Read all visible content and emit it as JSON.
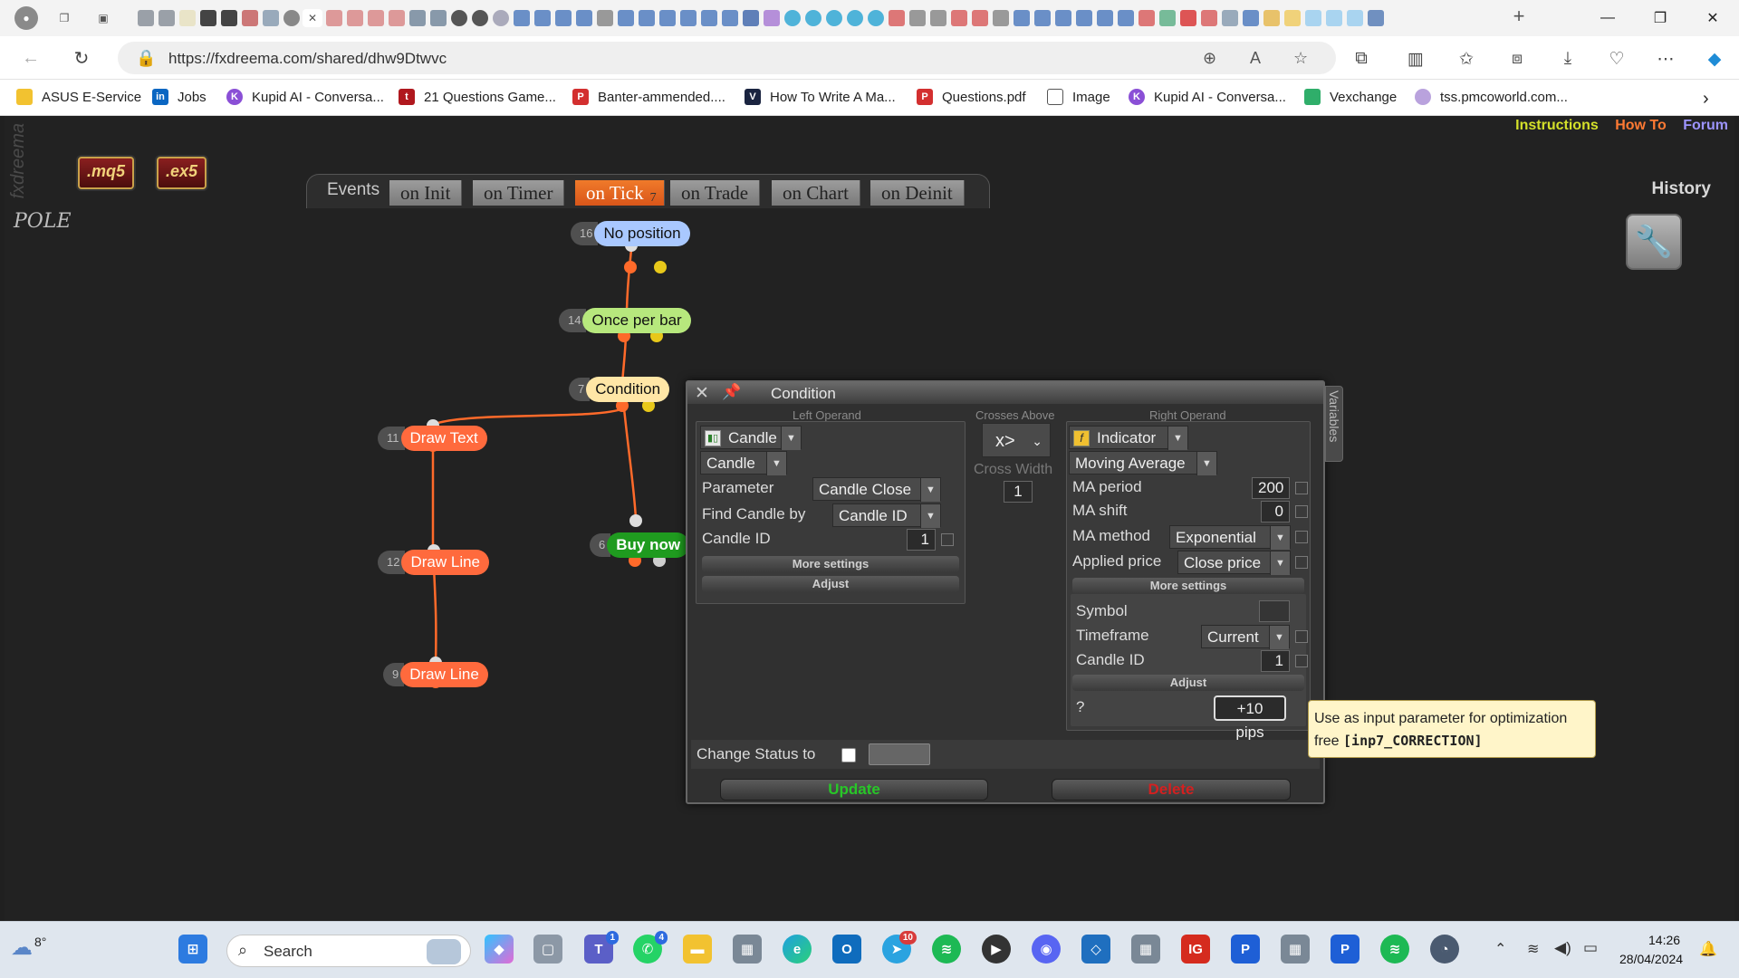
{
  "browser": {
    "url": "https://fxdreema.com/shared/dhw9Dtwvc",
    "bookmarks": [
      "ASUS E-Service",
      "Jobs",
      "Kupid AI - Conversa...",
      "21 Questions Game...",
      "Banter-ammended....",
      "How To Write A Ma...",
      "Questions.pdf",
      "Image",
      "Kupid AI - Conversa...",
      "Vexchange",
      "tss.pmcoworld.com..."
    ],
    "win_controls": {
      "minimize": "—",
      "maximize": "❐",
      "close": "✕"
    }
  },
  "app": {
    "logo_vertical": "fxdreema",
    "links": {
      "instructions": "Instructions",
      "howto": "How To",
      "forum": "Forum"
    },
    "files": {
      "mq5": ".mq5",
      "ex5": ".ex5"
    },
    "project_name": "POLE",
    "events_label": "Events",
    "event_tabs": [
      "on Init",
      "on Timer",
      "on Tick",
      "on Trade",
      "on Chart",
      "on Deinit"
    ],
    "active_tab_badge": "7",
    "history": "History",
    "nodes": [
      {
        "num": "16",
        "label": "No position"
      },
      {
        "num": "14",
        "label": "Once per bar"
      },
      {
        "num": "7",
        "label": "Condition"
      },
      {
        "num": "11",
        "label": "Draw Text"
      },
      {
        "num": "6",
        "label": "Buy now"
      },
      {
        "num": "12",
        "label": "Draw Line"
      },
      {
        "num": "9",
        "label": "Draw Line"
      }
    ]
  },
  "dialog": {
    "title": "Condition",
    "variables_tab": "Variables",
    "left": {
      "section": "Left Operand",
      "type": "Candle",
      "subtype": "Candle",
      "parameter_label": "Parameter",
      "parameter_value": "Candle Close",
      "find_label": "Find Candle by",
      "find_value": "Candle ID",
      "candle_id_label": "Candle ID",
      "candle_id_value": "1",
      "more_settings": "More settings",
      "adjust": "Adjust"
    },
    "middle": {
      "section": "Crosses Above",
      "operator": "x>",
      "cross_width_label": "Cross Width",
      "cross_width_value": "1"
    },
    "right": {
      "section": "Right Operand",
      "type": "Indicator",
      "subtype": "Moving Average",
      "ma_period_label": "MA period",
      "ma_period_value": "200",
      "ma_shift_label": "MA shift",
      "ma_shift_value": "0",
      "ma_method_label": "MA method",
      "ma_method_value": "Exponential",
      "applied_price_label": "Applied price",
      "applied_price_value": "Close price",
      "more_settings": "More settings",
      "symbol_label": "Symbol",
      "symbol_value": "",
      "timeframe_label": "Timeframe",
      "timeframe_value": "Current",
      "candle_id_label": "Candle ID",
      "candle_id_value": "1",
      "adjust": "Adjust",
      "adjust_q": "?",
      "adjust_value": "+10 pips"
    },
    "change_status_label": "Change Status to",
    "update": "Update",
    "delete": "Delete"
  },
  "tooltip": {
    "line1": "Use as input parameter for optimization",
    "line2_prefix": "free ",
    "line2_code": "[inp7_CORRECTION]"
  },
  "taskbar": {
    "weather": "8°",
    "search_placeholder": "Search",
    "time": "14:26",
    "date": "28/04/2024",
    "badges": {
      "teams": "1",
      "whatsapp": "4",
      "telegram": "10"
    }
  },
  "colors": {
    "active_tab": "#e8642a",
    "instructions": "#d4e02a",
    "howto": "#ff7a33",
    "forum": "#9d94ff",
    "update": "#28c628",
    "delete": "#d32020",
    "wire": "#ff6a2a"
  }
}
